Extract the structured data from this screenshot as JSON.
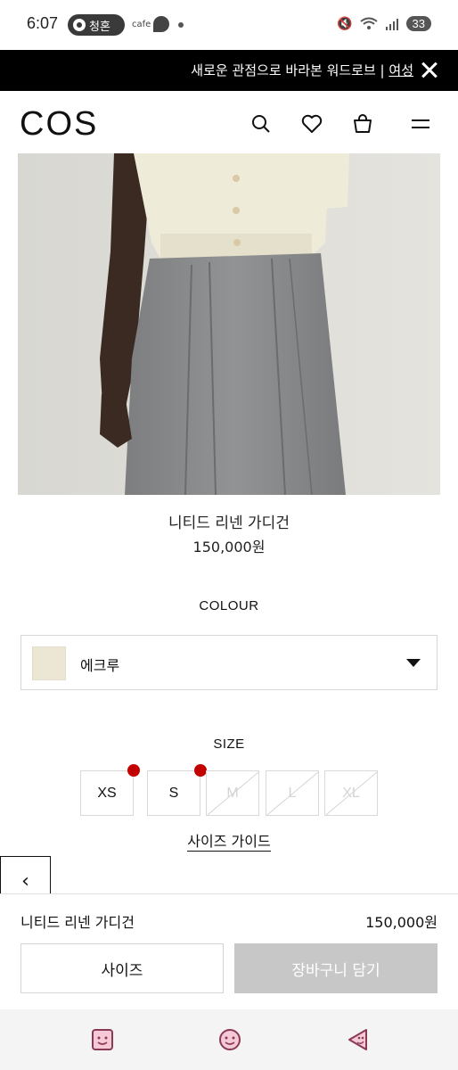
{
  "status_bar": {
    "time": "6:07",
    "app_pill": "청혼",
    "cafe": "cafe",
    "battery": "33"
  },
  "announcement": {
    "text": "새로운 관점으로 바라본 워드로브 | ",
    "link": "여성"
  },
  "header": {
    "logo": "COS",
    "icons": [
      "search-icon",
      "heart-icon",
      "bag-icon",
      "menu-icon"
    ]
  },
  "product": {
    "name": "니티드 리넨 가디건",
    "price": "150,000원"
  },
  "colour": {
    "label": "COLOUR",
    "selected": "에크루",
    "swatch_color": "#ece7d4"
  },
  "size": {
    "label": "SIZE",
    "options": [
      {
        "label": "XS",
        "available": true,
        "alert": true
      },
      {
        "label": "S",
        "available": true,
        "alert": true
      },
      {
        "label": "M",
        "available": false,
        "alert": false
      },
      {
        "label": "L",
        "available": false,
        "alert": false
      },
      {
        "label": "XL",
        "available": false,
        "alert": false
      }
    ],
    "guide": "사이즈 가이드"
  },
  "back_button": "‹",
  "sticky": {
    "name": "니티드 리넨 가디건",
    "price": "150,000원",
    "size_button": "사이즈",
    "cart_button": "장바구니 담기"
  },
  "colors": {
    "alert_dot": "#c30000",
    "cart_disabled": "#c7c7c7"
  }
}
